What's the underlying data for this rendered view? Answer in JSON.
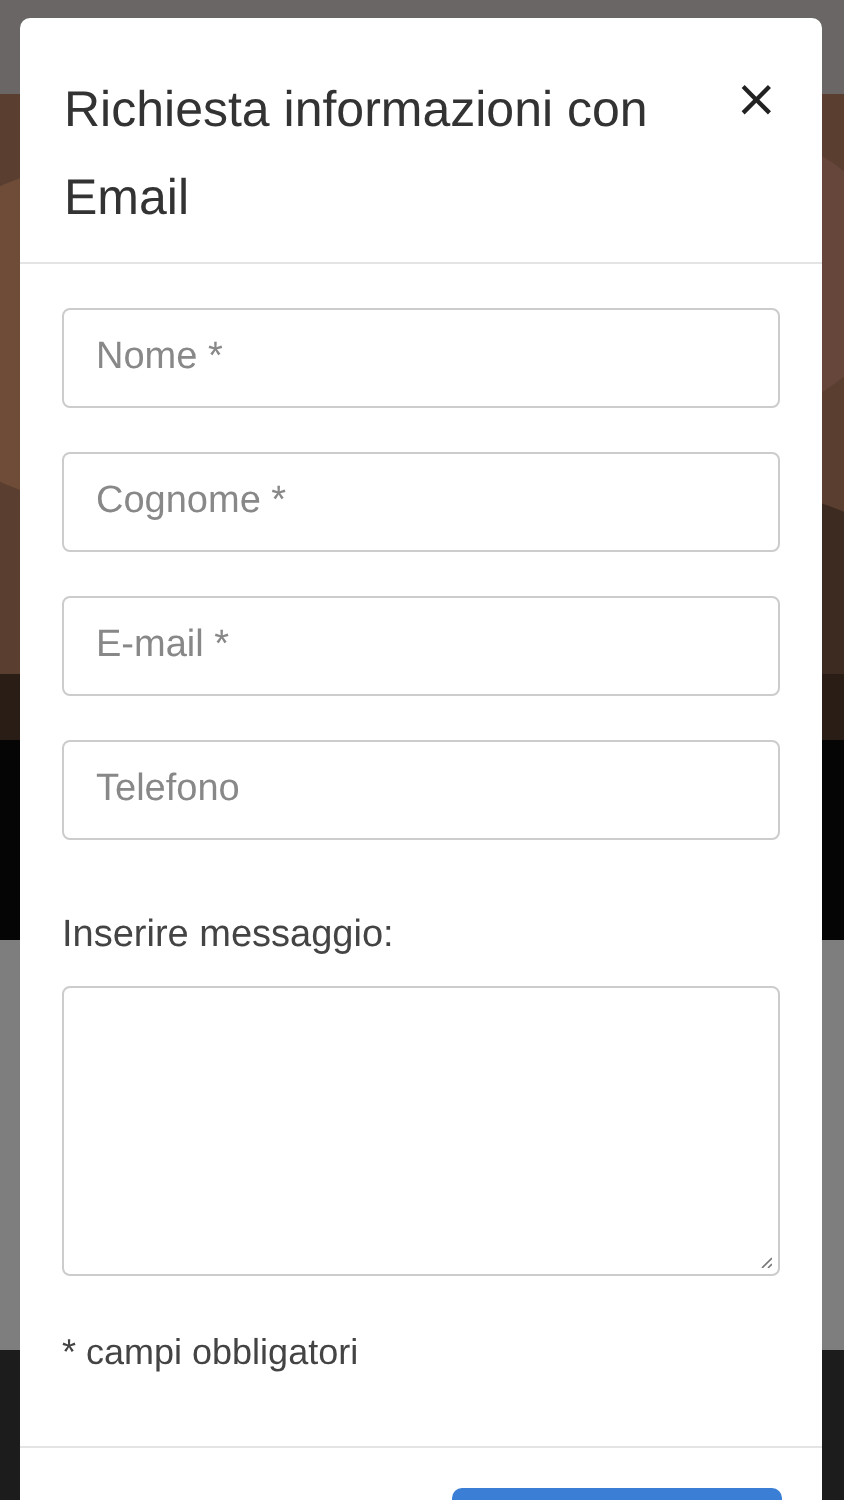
{
  "modal": {
    "title": "Richiesta informazioni con Email",
    "close": "×",
    "fields": [
      {
        "placeholder": "Nome *"
      },
      {
        "placeholder": "Cognome *"
      },
      {
        "placeholder": "E-mail *"
      },
      {
        "placeholder": "Telefono"
      }
    ],
    "message_label": "Inserire messaggio:",
    "note": "* campi obbligatori"
  }
}
